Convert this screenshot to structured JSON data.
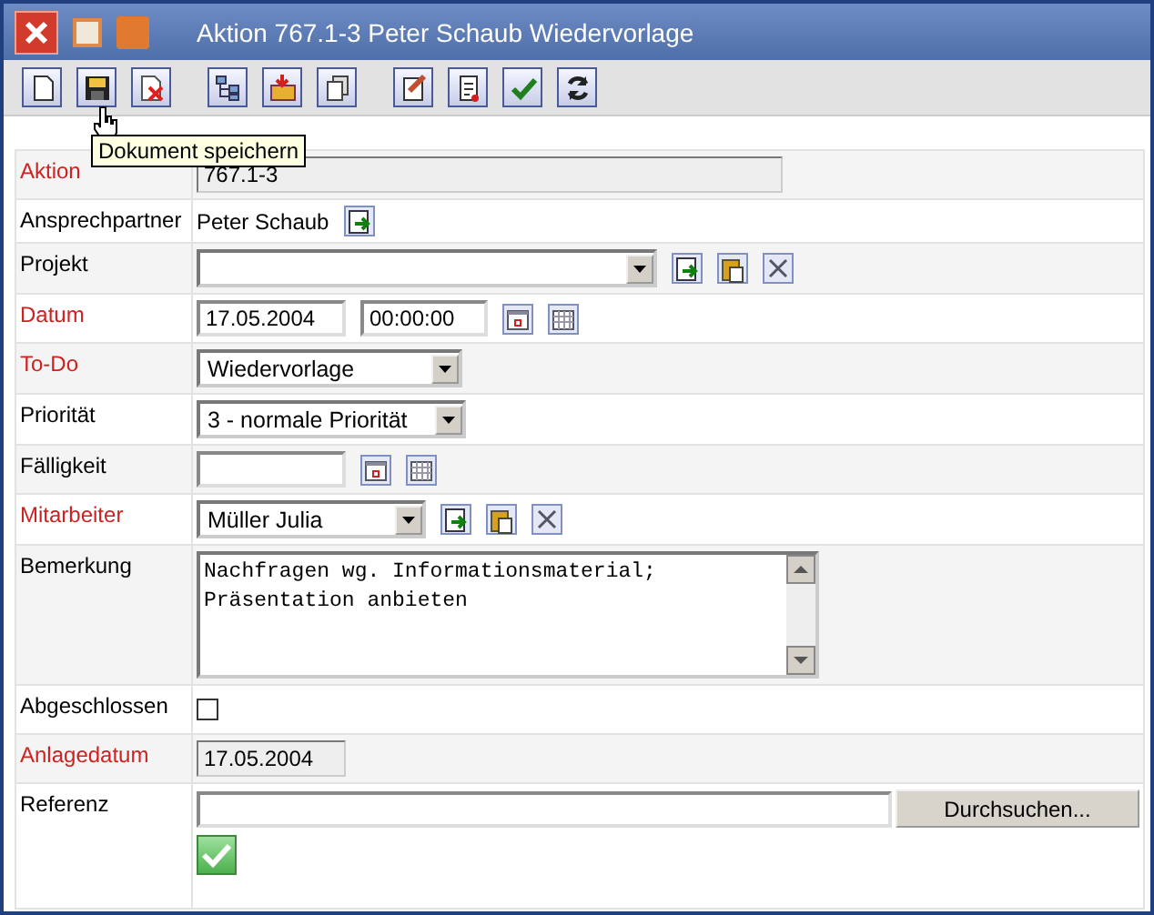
{
  "window": {
    "title": "Aktion 767.1-3 Peter Schaub Wiedervorlage"
  },
  "toolbar": [
    [
      {
        "kind": "new"
      },
      {
        "kind": "save"
      },
      {
        "kind": "delete"
      }
    ],
    [
      {
        "kind": "tree"
      },
      {
        "kind": "open"
      },
      {
        "kind": "copy"
      }
    ],
    [
      {
        "kind": "edit"
      },
      {
        "kind": "report"
      },
      {
        "kind": "ok"
      },
      {
        "kind": "refresh"
      }
    ]
  ],
  "tooltip": {
    "text": "Dokument speichern"
  },
  "fields": [
    {
      "label": "Aktion",
      "required": true,
      "kind": "readonly",
      "value": "767.1-3"
    },
    {
      "label": "Ansprechpartner",
      "required": false,
      "kind": "text",
      "value": "Peter Schaub",
      "actions": [
        {
          "kind": "link"
        }
      ]
    },
    {
      "label": "Projekt",
      "required": false,
      "kind": "select",
      "actions": [
        {
          "kind": "link"
        },
        {
          "kind": "paste"
        },
        {
          "kind": "clear"
        }
      ]
    },
    {
      "label": "Datum",
      "required": true,
      "kind": "datetime",
      "date": "17.05.2004",
      "time": "00:00:00",
      "actions": [
        {
          "kind": "calendar"
        },
        {
          "kind": "grid"
        }
      ]
    },
    {
      "label": "To-Do",
      "required": true,
      "kind": "select",
      "value": "Wiedervorlage"
    },
    {
      "label": "Priorität",
      "required": false,
      "kind": "select",
      "value": "3 - normale Priorität"
    },
    {
      "label": "Fälligkeit",
      "required": false,
      "kind": "datetime",
      "actions": [
        {
          "kind": "calendar"
        },
        {
          "kind": "grid"
        }
      ]
    },
    {
      "label": "Mitarbeiter",
      "required": true,
      "kind": "select",
      "value": "Müller Julia",
      "actions": [
        {
          "kind": "link"
        },
        {
          "kind": "paste"
        },
        {
          "kind": "clear"
        }
      ]
    },
    {
      "label": "Bemerkung",
      "required": false,
      "kind": "textarea",
      "lines": [
        "Nachfragen wg. Informationsmaterial;",
        "Präsentation anbieten"
      ]
    },
    {
      "label": "Abgeschlossen",
      "required": false,
      "kind": "checkbox",
      "checked": false
    },
    {
      "label": "Anlagedatum",
      "required": true,
      "kind": "readonly",
      "value": "17.05.2004"
    },
    {
      "label": "Referenz",
      "required": false,
      "kind": "file",
      "button": "Durchsuchen...",
      "actions": [
        {
          "kind": "ok"
        }
      ]
    }
  ]
}
